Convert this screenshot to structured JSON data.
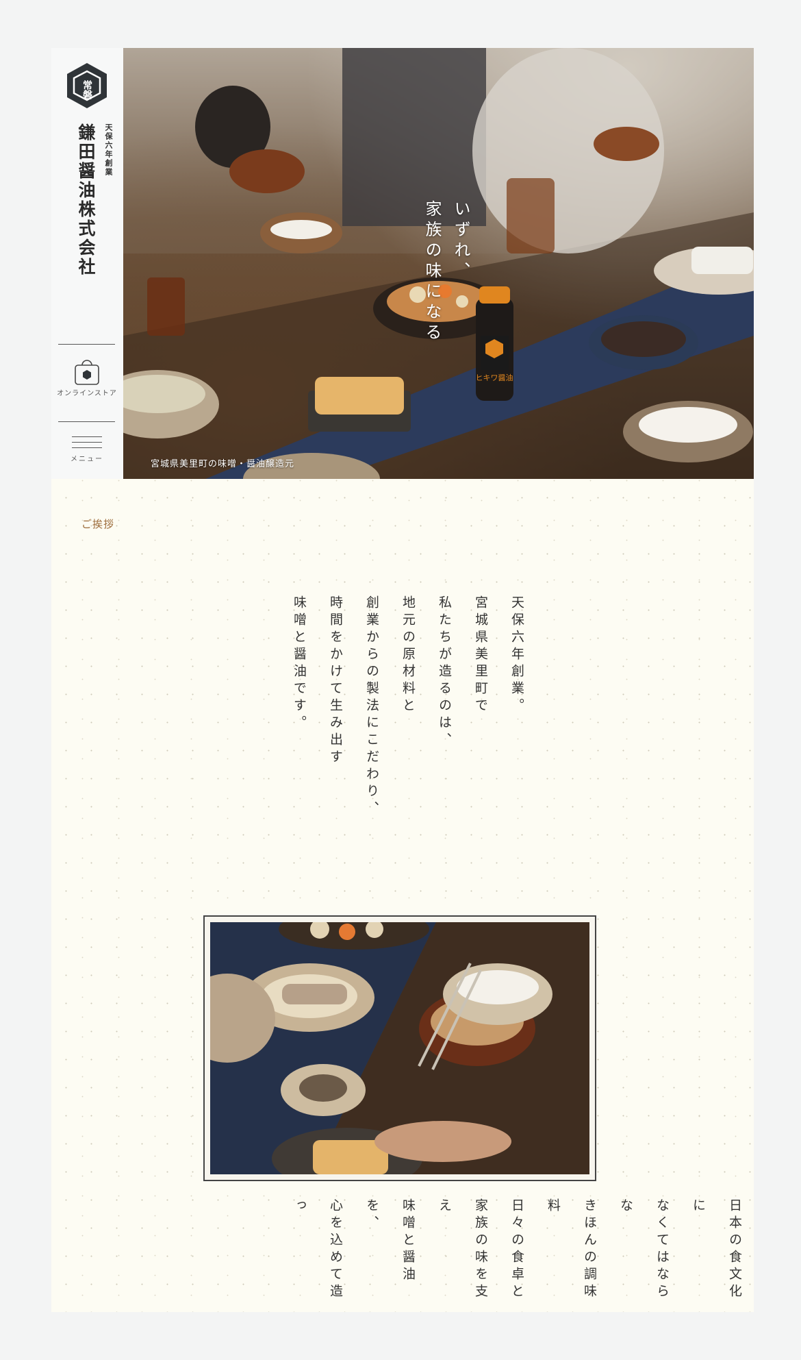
{
  "brand": {
    "logo_glyph": "常磐",
    "name": "鎌田醤油株式会社",
    "founded": "天保六年創業",
    "colors": {
      "accent": "#9c6b3a",
      "logo": "#2f3438"
    }
  },
  "nav": {
    "online_store_label": "オンラインストア",
    "online_store_icon": "shopping-bag-icon",
    "menu_label": "メニュー",
    "menu_icon": "hamburger-icon"
  },
  "hero": {
    "copy_lines": [
      "いずれ、",
      "家族の味になる"
    ],
    "caption": "宮城県美里町の味噌・醤油醸造元",
    "bottle_label": "キッコー\nヒキワ醤油"
  },
  "greeting": {
    "label": "ご挨拶",
    "paragraph_1": [
      "天保六年創業。",
      "宮城県美里町で",
      "私たちが造るのは、",
      "地元の原材料と",
      "創業からの製法にこだわり、",
      "時間をかけて生み出す",
      "味噌と醤油です。"
    ],
    "paragraph_2": [
      "日本の食文化に",
      "なくてはならな",
      "きほんの調味料",
      "日々の食卓と",
      "家族の味を支え",
      "味噌と醤油を、",
      "心を込めて造っ"
    ]
  }
}
